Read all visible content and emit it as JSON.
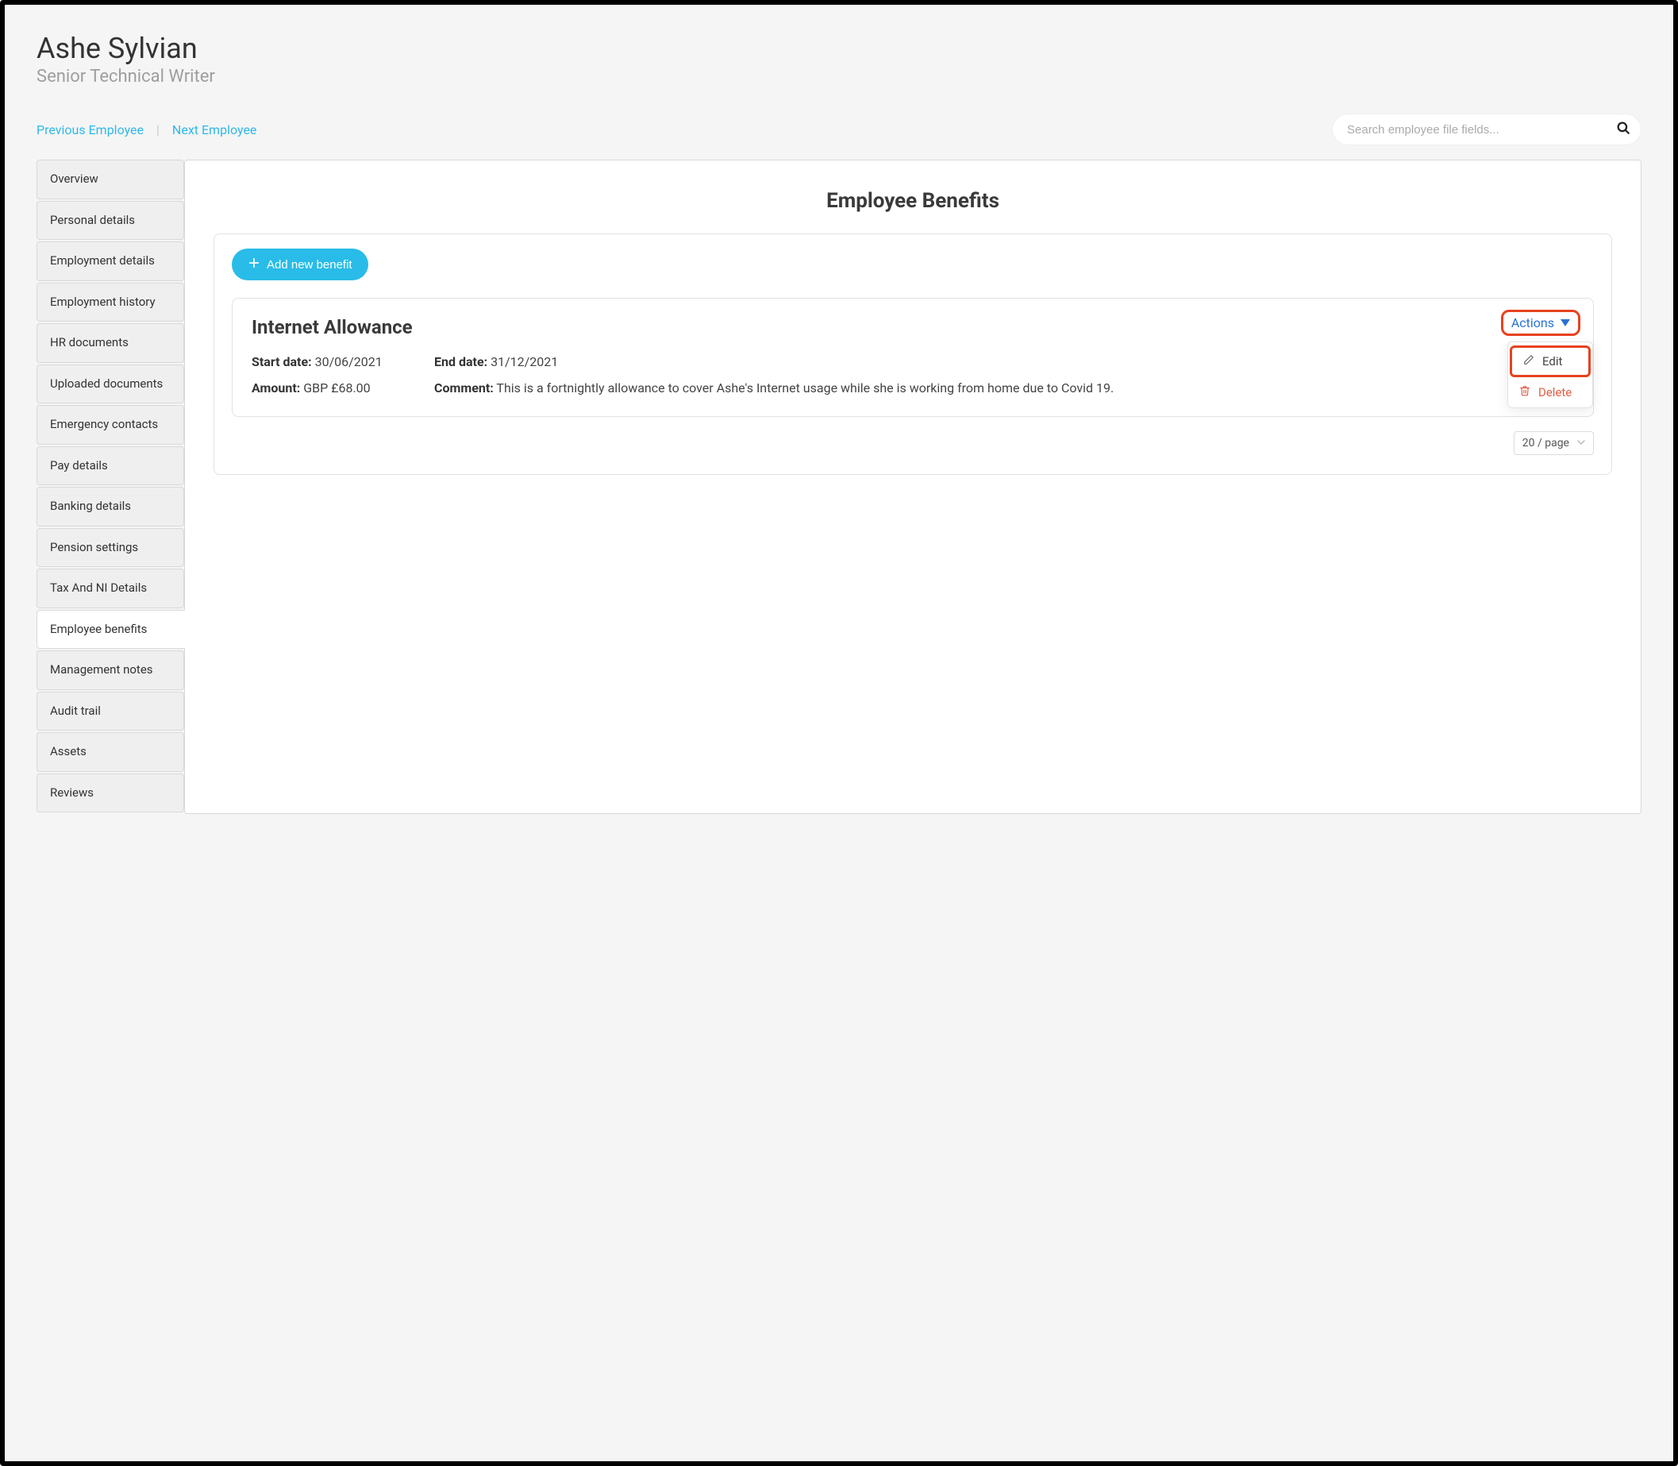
{
  "header": {
    "employee_name": "Ashe Sylvian",
    "employee_title": "Senior Technical Writer",
    "prev_label": "Previous Employee",
    "nav_sep": "|",
    "next_label": "Next Employee"
  },
  "search": {
    "placeholder": "Search employee file fields...",
    "value": ""
  },
  "sidebar": {
    "items": [
      {
        "label": "Overview",
        "active": false
      },
      {
        "label": "Personal details",
        "active": false
      },
      {
        "label": "Employment details",
        "active": false
      },
      {
        "label": "Employment history",
        "active": false
      },
      {
        "label": "HR documents",
        "active": false
      },
      {
        "label": "Uploaded documents",
        "active": false
      },
      {
        "label": "Emergency contacts",
        "active": false
      },
      {
        "label": "Pay details",
        "active": false
      },
      {
        "label": "Banking details",
        "active": false
      },
      {
        "label": "Pension settings",
        "active": false
      },
      {
        "label": "Tax And NI Details",
        "active": false
      },
      {
        "label": "Employee benefits",
        "active": true
      },
      {
        "label": "Management notes",
        "active": false
      },
      {
        "label": "Audit trail",
        "active": false
      },
      {
        "label": "Assets",
        "active": false
      },
      {
        "label": "Reviews",
        "active": false
      }
    ]
  },
  "main": {
    "page_title": "Employee Benefits",
    "add_button": "Add new benefit",
    "benefit": {
      "title": "Internet Allowance",
      "actions_label": "Actions",
      "dropdown": {
        "edit": "Edit",
        "delete": "Delete"
      },
      "start_label": "Start date:",
      "start_value": "30/06/2021",
      "end_label": "End date:",
      "end_value": "31/12/2021",
      "amount_label": "Amount:",
      "amount_value": "GBP £68.00",
      "comment_label": "Comment:",
      "comment_value": "This is a fortnightly allowance to cover Ashe's Internet usage while she is working from home due to Covid 19."
    },
    "pager": "20 / page"
  },
  "colors": {
    "accent": "#29bce8",
    "link": "#2872d6",
    "danger": "#e35b41",
    "highlight_border": "#e74220"
  }
}
